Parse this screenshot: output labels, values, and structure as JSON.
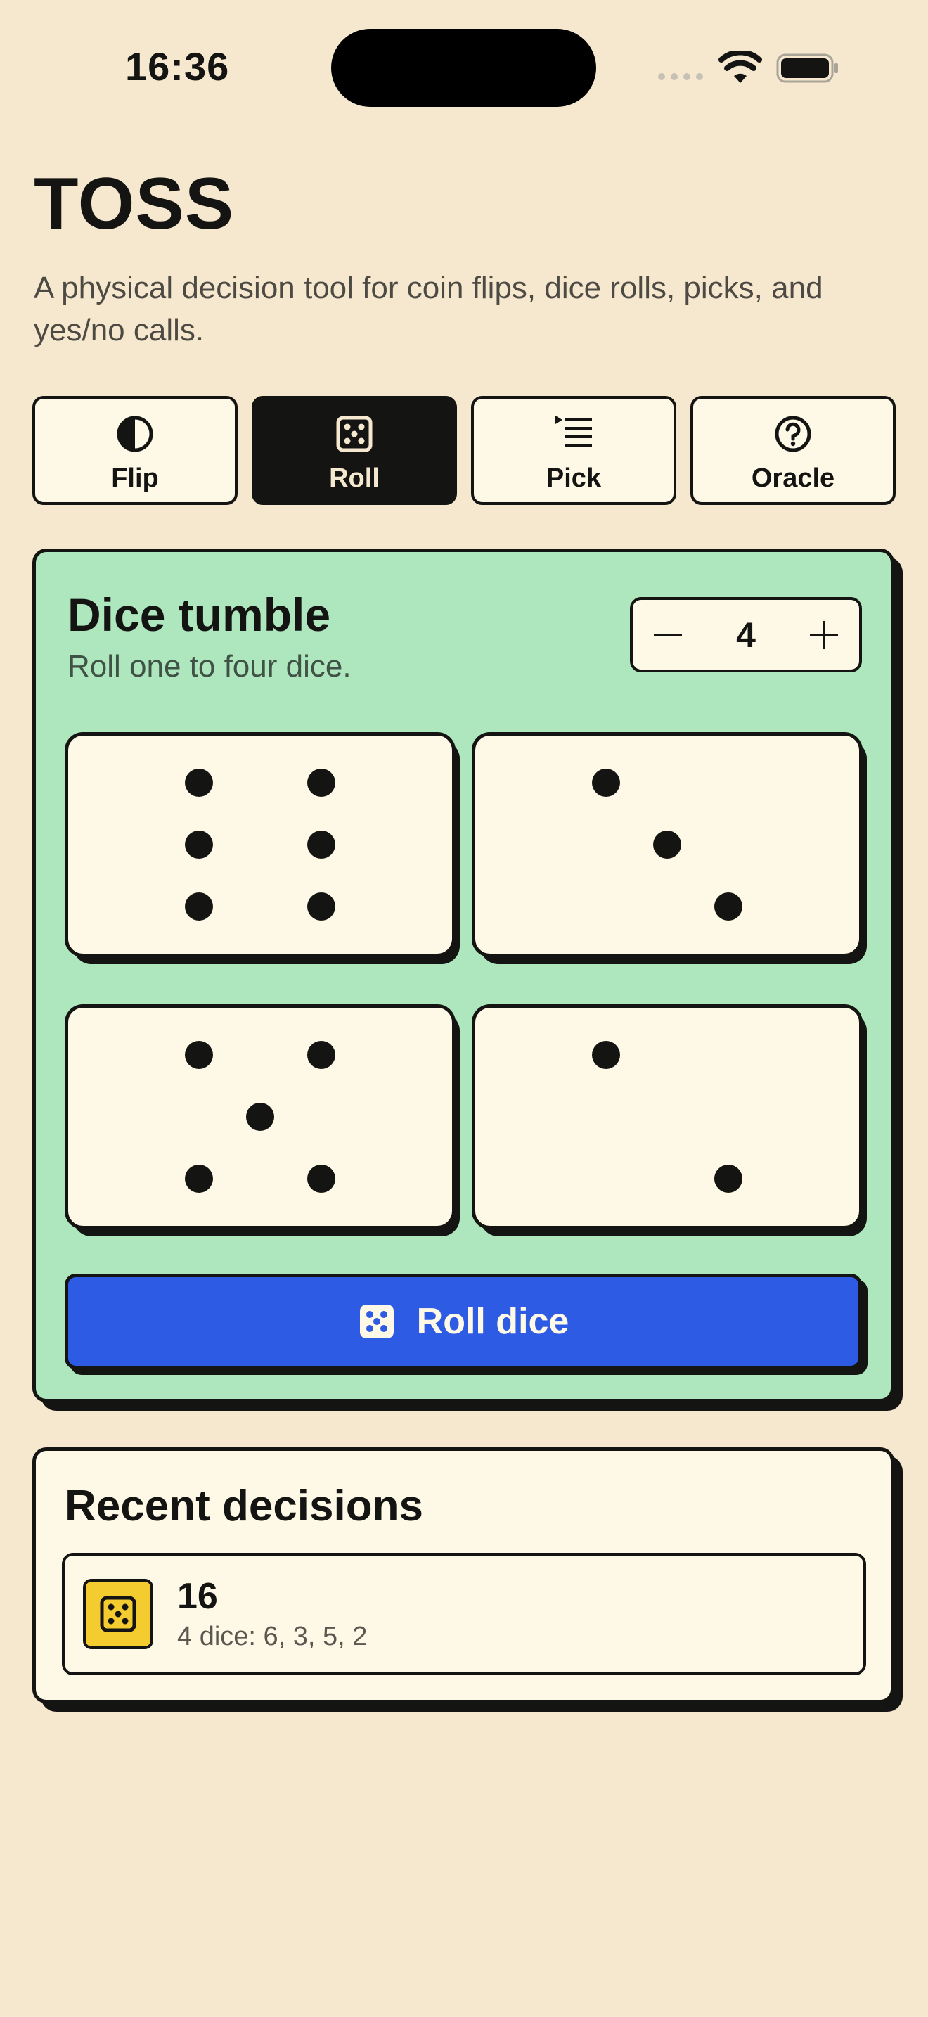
{
  "status": {
    "time": "16:36"
  },
  "header": {
    "title": "TOSS",
    "subtitle": "A physical decision tool for coin flips, dice rolls, picks, and yes/no calls."
  },
  "tabs": [
    {
      "label": "Flip",
      "icon": "half-circle-icon",
      "active": false
    },
    {
      "label": "Roll",
      "icon": "dice-icon",
      "active": true
    },
    {
      "label": "Pick",
      "icon": "list-icon",
      "active": false
    },
    {
      "label": "Oracle",
      "icon": "question-circle-icon",
      "active": false
    }
  ],
  "dice_card": {
    "title": "Dice tumble",
    "subtitle": "Roll one to four dice.",
    "stepper": {
      "minus": "−",
      "value": "4",
      "plus": "+"
    },
    "dice": [
      6,
      3,
      5,
      2
    ],
    "roll_button": "Roll dice"
  },
  "recent": {
    "title": "Recent decisions",
    "items": [
      {
        "value": "16",
        "detail": "4 dice: 6, 3, 5, 2",
        "icon": "dice-icon"
      }
    ]
  },
  "colors": {
    "background": "#F6E8CF",
    "card_green": "#AEE6BE",
    "button_blue": "#2E5BE3",
    "ink": "#141412",
    "paper": "#FEF9E7",
    "accent_yellow": "#F5CC2F"
  }
}
